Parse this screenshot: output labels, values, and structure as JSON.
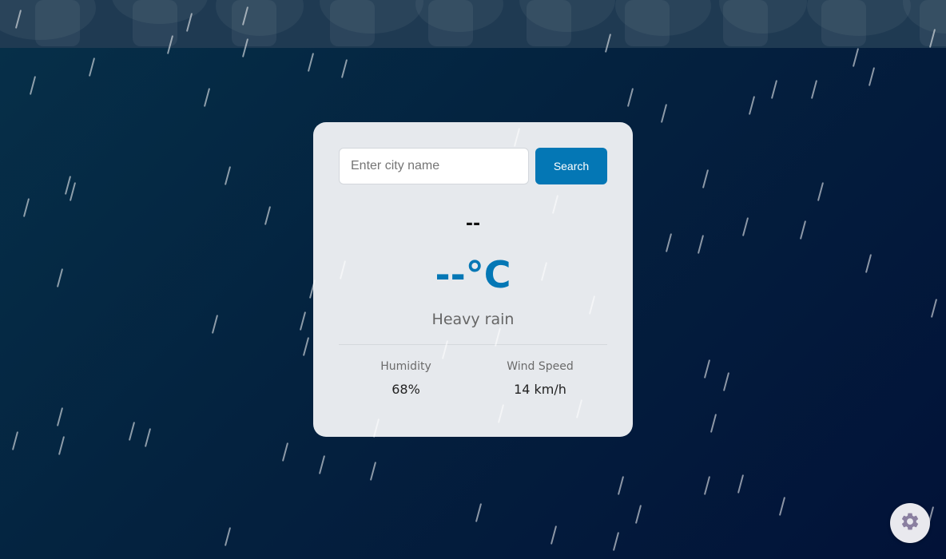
{
  "search": {
    "placeholder": "Enter city name",
    "value": "",
    "button_label": "Search"
  },
  "weather": {
    "city": "--",
    "temperature": "--°C",
    "description": "Heavy rain",
    "humidity_label": "Humidity",
    "humidity_value": "68%",
    "wind_label": "Wind Speed",
    "wind_value": "14 km/h"
  },
  "settings": {
    "icon": "gear-icon"
  },
  "colors": {
    "accent": "#0477b5",
    "card_background": "#e6e9ed",
    "background_dark": "#021238",
    "gear": "#8a7fa0"
  }
}
